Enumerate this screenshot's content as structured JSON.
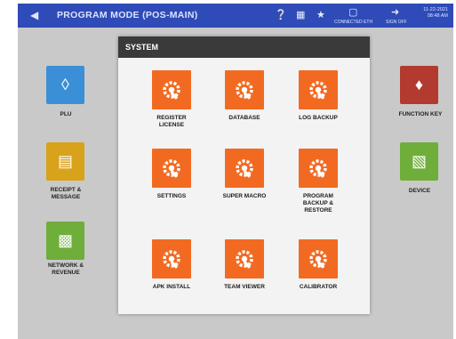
{
  "topbar": {
    "title": "PROGRAM MODE (POS-MAIN)",
    "connected_label": "CONNECTED ETH",
    "signoff_label": "SIGN OFF",
    "date": "11-22-2021",
    "time": "08:48 AM"
  },
  "background_tiles": [
    {
      "label": "PLU",
      "color": "#3b8fd6",
      "icon": "tag-icon"
    },
    {
      "label": "RECEIPT & MESSAGE",
      "color": "#d9a21b",
      "icon": "receipt-icon"
    },
    {
      "label": "NETWORK & REVENUE",
      "color": "#6fae3a",
      "icon": "monitor-icon"
    },
    {
      "label": "FUNCTION KEY",
      "color": "#b23a2e",
      "icon": "key-icon"
    },
    {
      "label": "DEVICE",
      "color": "#6fae3a",
      "icon": "printer-icon"
    }
  ],
  "modal": {
    "title": "SYSTEM",
    "items": [
      {
        "label_line1": "REGISTER",
        "label_line2": "LICENSE",
        "label_line3": ""
      },
      {
        "label_line1": "DATABASE",
        "label_line2": "",
        "label_line3": ""
      },
      {
        "label_line1": "LOG BACKUP",
        "label_line2": "",
        "label_line3": ""
      },
      {
        "label_line1": "SETTINGS",
        "label_line2": "",
        "label_line3": ""
      },
      {
        "label_line1": "SUPER MACRO",
        "label_line2": "",
        "label_line3": ""
      },
      {
        "label_line1": "PROGRAM",
        "label_line2": "BACKUP &",
        "label_line3": "RESTORE"
      },
      {
        "label_line1": "APK INSTALL",
        "label_line2": "",
        "label_line3": ""
      },
      {
        "label_line1": "TEAM VIEWER",
        "label_line2": "",
        "label_line3": ""
      },
      {
        "label_line1": "CALIBRATOR",
        "label_line2": "",
        "label_line3": ""
      }
    ],
    "accent_color": "#f26a21"
  }
}
